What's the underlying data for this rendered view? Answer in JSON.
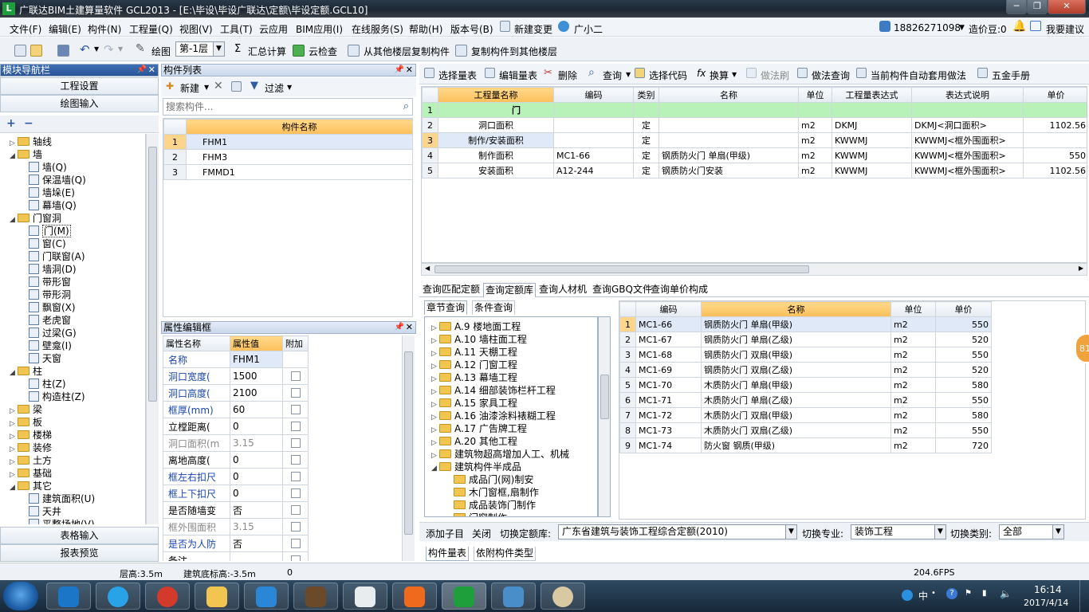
{
  "window": {
    "title": "广联达BIM土建算量软件 GCL2013 - [E:\\毕设\\毕设广联达\\定额\\毕设定额.GCL10]",
    "logo": "L",
    "min": "─",
    "max": "❐",
    "close": "✕"
  },
  "menu": [
    "文件(F)",
    "编辑(E)",
    "构件(N)",
    "工程量(Q)",
    "视图(V)",
    "工具(T)",
    "云应用",
    "BIM应用(I)",
    "在线服务(S)",
    "帮助(H)",
    "版本号(B)",
    "新建变更",
    "广小二"
  ],
  "account": {
    "phone": "18826271098",
    "beans": "造价豆:0",
    "help": "我要建议"
  },
  "toolbar": {
    "draw": "绘图",
    "floor": "第-1层",
    "sum": "汇总计算",
    "cloud_check": "云检查",
    "copy_from": "从其他楼层复制构件",
    "copy_to": "复制构件到其他楼层"
  },
  "nav": {
    "title": "模块导航栏",
    "project_settings": "工程设置",
    "drawing_input": "绘图输入",
    "table_input": "表格输入",
    "report_preview": "报表预览"
  },
  "tree": [
    {
      "label": "轴线",
      "level": 0,
      "type": "folder",
      "exp": "▷"
    },
    {
      "label": "墙",
      "level": 0,
      "type": "folder",
      "exp": "◢"
    },
    {
      "label": "墙(Q)",
      "level": 1,
      "type": "leaf"
    },
    {
      "label": "保温墙(Q)",
      "level": 1,
      "type": "leaf"
    },
    {
      "label": "墙垛(E)",
      "level": 1,
      "type": "leaf"
    },
    {
      "label": "幕墙(Q)",
      "level": 1,
      "type": "leaf"
    },
    {
      "label": "门窗洞",
      "level": 0,
      "type": "folder",
      "exp": "◢"
    },
    {
      "label": "门(M)",
      "level": 1,
      "type": "leaf",
      "selected": true
    },
    {
      "label": "窗(C)",
      "level": 1,
      "type": "leaf"
    },
    {
      "label": "门联窗(A)",
      "level": 1,
      "type": "leaf"
    },
    {
      "label": "墙洞(D)",
      "level": 1,
      "type": "leaf"
    },
    {
      "label": "带形窗",
      "level": 1,
      "type": "leaf"
    },
    {
      "label": "带形洞",
      "level": 1,
      "type": "leaf"
    },
    {
      "label": "飘窗(X)",
      "level": 1,
      "type": "leaf"
    },
    {
      "label": "老虎窗",
      "level": 1,
      "type": "leaf"
    },
    {
      "label": "过梁(G)",
      "level": 1,
      "type": "leaf"
    },
    {
      "label": "壁龛(I)",
      "level": 1,
      "type": "leaf"
    },
    {
      "label": "天窗",
      "level": 1,
      "type": "leaf"
    },
    {
      "label": "柱",
      "level": 0,
      "type": "folder",
      "exp": "◢"
    },
    {
      "label": "柱(Z)",
      "level": 1,
      "type": "leaf"
    },
    {
      "label": "构造柱(Z)",
      "level": 1,
      "type": "leaf"
    },
    {
      "label": "梁",
      "level": 0,
      "type": "folder",
      "exp": "▷"
    },
    {
      "label": "板",
      "level": 0,
      "type": "folder",
      "exp": "▷"
    },
    {
      "label": "楼梯",
      "level": 0,
      "type": "folder",
      "exp": "▷"
    },
    {
      "label": "装修",
      "level": 0,
      "type": "folder",
      "exp": "▷"
    },
    {
      "label": "土方",
      "level": 0,
      "type": "folder",
      "exp": "▷"
    },
    {
      "label": "基础",
      "level": 0,
      "type": "folder",
      "exp": "▷"
    },
    {
      "label": "其它",
      "level": 0,
      "type": "folder",
      "exp": "◢"
    },
    {
      "label": "建筑面积(U)",
      "level": 1,
      "type": "leaf"
    },
    {
      "label": "天井",
      "level": 1,
      "type": "leaf"
    },
    {
      "label": "平整场地(V)",
      "level": 1,
      "type": "leaf"
    }
  ],
  "components": {
    "title": "构件列表",
    "new": "新建",
    "filter": "过滤",
    "search_placeholder": "搜索构件...",
    "header": "构件名称",
    "rows": [
      [
        "1",
        "FHM1"
      ],
      [
        "2",
        "FHM3"
      ],
      [
        "3",
        "FMMD1"
      ]
    ]
  },
  "props": {
    "title": "属性编辑框",
    "headers": [
      "属性名称",
      "属性值",
      "附加"
    ],
    "rows": [
      {
        "name": "名称",
        "value": "FHM1",
        "style": "blue",
        "cb": false
      },
      {
        "name": "洞口宽度(",
        "value": "1500",
        "style": "blue",
        "cb": true
      },
      {
        "name": "洞口高度(",
        "value": "2100",
        "style": "blue",
        "cb": true
      },
      {
        "name": "框厚(mm)",
        "value": "60",
        "style": "blue",
        "cb": true
      },
      {
        "name": "立樘距离(",
        "value": "0",
        "style": "",
        "cb": true
      },
      {
        "name": "洞口面积(m",
        "value": "3.15",
        "style": "gray",
        "cb": true
      },
      {
        "name": "离地高度(",
        "value": "0",
        "style": "",
        "cb": true
      },
      {
        "name": "框左右扣尺",
        "value": "0",
        "style": "blue",
        "cb": true
      },
      {
        "name": "框上下扣尺",
        "value": "0",
        "style": "blue",
        "cb": true
      },
      {
        "name": "是否随墙变",
        "value": "否",
        "style": "",
        "cb": true
      },
      {
        "name": "框外围面积",
        "value": "3.15",
        "style": "gray",
        "cb": true
      },
      {
        "name": "是否为人防",
        "value": "否",
        "style": "blue",
        "cb": true
      },
      {
        "name": "备注",
        "value": "",
        "style": "",
        "cb": true
      }
    ]
  },
  "qtoolbar": {
    "select_qty": "选择量表",
    "edit_qty": "编辑量表",
    "delete": "删除",
    "query": "查询",
    "select_code": "选择代码",
    "convert": "换算",
    "method_brush": "做法刷",
    "method_query": "做法查询",
    "auto_apply": "当前构件自动套用做法",
    "hardware": "五金手册"
  },
  "qtable": {
    "headers": [
      "",
      "工程量名称",
      "编码",
      "类别",
      "名称",
      "单位",
      "工程量表达式",
      "表达式说明",
      "单价"
    ],
    "rows": [
      [
        "1",
        "门",
        "",
        "",
        "",
        "",
        "",
        "",
        ""
      ],
      [
        "2",
        "洞口面积",
        "",
        "定",
        "",
        "m2",
        "DKMJ",
        "DKMJ<洞口面积>",
        "1102.56"
      ],
      [
        "3",
        "制作/安装面积",
        "",
        "定",
        "",
        "m2",
        "KWWMJ",
        "KWWMJ<框外围面积>",
        ""
      ],
      [
        "4",
        "制作面积",
        "MC1-66",
        "定",
        "钢质防火门 单扇(甲级)",
        "m2",
        "KWWMJ",
        "KWWMJ<框外围面积>",
        "550"
      ],
      [
        "5",
        "安装面积",
        "A12-244",
        "定",
        "钢质防火门安装",
        "m2",
        "KWWMJ",
        "KWWMJ<框外围面积>",
        "1102.56"
      ]
    ]
  },
  "qtabs": [
    "查询匹配定额",
    "查询定额库",
    "查询人材机",
    "查询GBQ文件",
    "查询单价构成"
  ],
  "subtabs": [
    "章节查询",
    "条件查询"
  ],
  "chapters": [
    {
      "label": "A.9 楼地面工程",
      "level": 0,
      "exp": "▷"
    },
    {
      "label": "A.10 墙柱面工程",
      "level": 0,
      "exp": "▷"
    },
    {
      "label": "A.11 天棚工程",
      "level": 0,
      "exp": "▷"
    },
    {
      "label": "A.12 门窗工程",
      "level": 0,
      "exp": "▷"
    },
    {
      "label": "A.13 幕墙工程",
      "level": 0,
      "exp": "▷"
    },
    {
      "label": "A.14 细部装饰栏杆工程",
      "level": 0,
      "exp": "▷"
    },
    {
      "label": "A.15 家具工程",
      "level": 0,
      "exp": "▷"
    },
    {
      "label": "A.16 油漆涂料裱糊工程",
      "level": 0,
      "exp": "▷"
    },
    {
      "label": "A.17 广告牌工程",
      "level": 0,
      "exp": "▷"
    },
    {
      "label": "A.20 其他工程",
      "level": 0,
      "exp": "▷"
    },
    {
      "label": "建筑物超高增加人工、机械",
      "level": 0,
      "exp": "▷"
    },
    {
      "label": "建筑构件半成品",
      "level": 0,
      "exp": "◢"
    },
    {
      "label": "成品门(网)制安",
      "level": 1,
      "exp": ""
    },
    {
      "label": "木门窗框,扇制作",
      "level": 1,
      "exp": ""
    },
    {
      "label": "成品装饰门制作",
      "level": 1,
      "exp": ""
    },
    {
      "label": "门窗制作",
      "level": 1,
      "exp": ""
    }
  ],
  "quota": {
    "headers": [
      "",
      "编码",
      "名称",
      "单位",
      "单价"
    ],
    "rows": [
      [
        "1",
        "MC1-66",
        "钢质防火门 单扇(甲级)",
        "m2",
        "550"
      ],
      [
        "2",
        "MC1-67",
        "钢质防火门 单扇(乙级)",
        "m2",
        "520"
      ],
      [
        "3",
        "MC1-68",
        "钢质防火门 双扇(甲级)",
        "m2",
        "550"
      ],
      [
        "4",
        "MC1-69",
        "钢质防火门 双扇(乙级)",
        "m2",
        "520"
      ],
      [
        "5",
        "MC1-70",
        "木质防火门 单扇(甲级)",
        "m2",
        "580"
      ],
      [
        "6",
        "MC1-71",
        "木质防火门 单扇(乙级)",
        "m2",
        "550"
      ],
      [
        "7",
        "MC1-72",
        "木质防火门 双扇(甲级)",
        "m2",
        "580"
      ],
      [
        "8",
        "MC1-73",
        "木质防火门 双扇(乙级)",
        "m2",
        "550"
      ],
      [
        "9",
        "MC1-74",
        "防火窗 钢质(甲级)",
        "m2",
        "720"
      ]
    ]
  },
  "bottombar": {
    "add_child": "添加子目",
    "close": "关闭",
    "switch_lib": "切换定额库:",
    "lib": "广东省建筑与装饰工程综合定额(2010)",
    "switch_major": "切换专业:",
    "major": "装饰工程",
    "switch_cat": "切换类别:",
    "cat": "全部"
  },
  "bottomtabs": [
    "构件量表",
    "依附构件类型"
  ],
  "status": {
    "floor_height": "层高:3.5m",
    "base_elev": "建筑底标高:-3.5m",
    "value": "0",
    "fps": "204.6FPS"
  },
  "badge": "81",
  "clock": {
    "time": "16:14",
    "date": "2017/4/14"
  },
  "tray": {
    "lang": "中"
  },
  "colors": {
    "accent_orange": "#fbbf5b",
    "green_row": "#b9f2b9",
    "title_blue": "#2a5596"
  }
}
